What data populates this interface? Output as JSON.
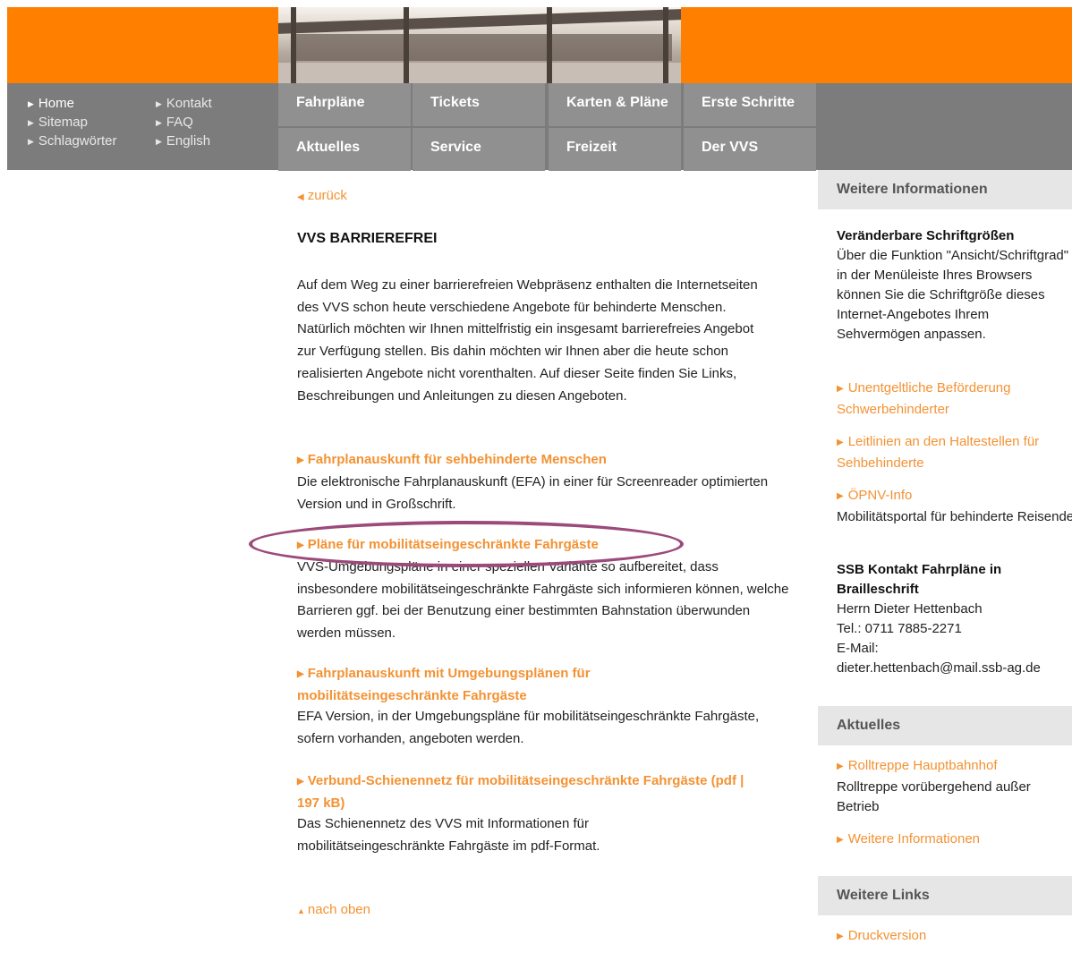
{
  "header": {
    "utility_links": [
      "Home",
      "Sitemap",
      "Schlagwörter",
      "Kontakt",
      "FAQ",
      "English"
    ],
    "main_nav": [
      "Fahrpläne",
      "Tickets",
      "Karten & Pläne",
      "Erste Schritte",
      "Aktuelles",
      "Service",
      "Freizeit",
      "Der VVS"
    ]
  },
  "content": {
    "back_link": "zurück",
    "title": "VVS BARRIEREFREI",
    "intro": "Auf dem Weg zu einer barrierefreien Webpräsenz enthalten die Internetseiten des VVS schon heute verschiedene Angebote für behinderte Menschen. Natürlich möchten wir Ihnen mittelfristig ein insgesamt barrierefreies Angebot zur Verfügung stellen. Bis dahin möchten wir Ihnen aber die heute schon realisierten Angebote nicht vorenthalten. Auf dieser Seite finden Sie Links, Beschreibungen und Anleitungen zu diesen Angeboten.",
    "entries": [
      {
        "title": "Fahrplanauskunft für sehbehinderte Menschen",
        "text": "Die elektronische Fahrplanauskunft (EFA) in einer für Screenreader optimierten Version und in Großschrift."
      },
      {
        "title": "Pläne für mobilitätseingeschränkte Fahrgäste",
        "text": "VVS-Umgebungspläne in einer speziellen Variante so aufbereitet, dass insbesondere mobilitätseingeschränkte Fahrgäste sich informieren können, welche Barrieren ggf. bei der Benutzung einer bestimmten Bahnstation überwunden werden müssen."
      },
      {
        "title": "Fahrplanauskunft mit Umgebungsplänen für mobilitätseingeschränkte Fahrgäste",
        "text": "EFA Version, in der Umgebungspläne für mobilitätseingeschränkte Fahrgäste, sofern vorhanden, angeboten werden."
      },
      {
        "title": "Verbund-Schienennetz für mobilitätseingeschränkte Fahrgäste (pdf | 197 kB)",
        "text": "Das Schienennetz des VVS mit Informationen für mobilitätseingeschränkte Fahrgäste im pdf-Format."
      }
    ],
    "to_top": "nach oben"
  },
  "sidebar": {
    "sections": [
      {
        "heading": "Weitere Informationen",
        "font_title": "Veränderbare Schriftgrößen",
        "font_text": "Über die Funktion \"Ansicht/Schriftgrad\" in der Menüleiste Ihres Browsers können Sie die Schriftgröße dieses Internet-Angebotes Ihrem Sehvermögen anpassen.",
        "links": [
          {
            "label": "Unentgeltliche Beförderung Schwerbehinderter",
            "desc": ""
          },
          {
            "label": "Leitlinien an den Haltestellen für Sehbehinderte",
            "desc": ""
          },
          {
            "label": "ÖPNV-Info",
            "desc": "Mobilitätsportal für behinderte Reisende"
          }
        ],
        "contact_title": "SSB Kontakt Fahrpläne in Brailleschrift",
        "contact_lines": [
          "Herrn Dieter Hettenbach",
          "Tel.: 0711 7885-2271",
          "E-Mail:",
          "dieter.hettenbach@mail.ssb-ag.de"
        ]
      },
      {
        "heading": "Aktuelles",
        "links": [
          {
            "label": "Rolltreppe Hauptbahnhof",
            "desc": "Rolltreppe vorübergehend außer Betrieb"
          },
          {
            "label": "Weitere Informationen",
            "desc": ""
          }
        ]
      },
      {
        "heading": "Weitere Links",
        "links": [
          {
            "label": "Druckversion",
            "desc": ""
          }
        ]
      }
    ]
  },
  "colors": {
    "accent": "#f39233",
    "header_orange": "#ff7f00",
    "nav_grey": "#7c7c7c",
    "nav_tile": "#909090",
    "highlight_ring": "#9b4a7a"
  }
}
